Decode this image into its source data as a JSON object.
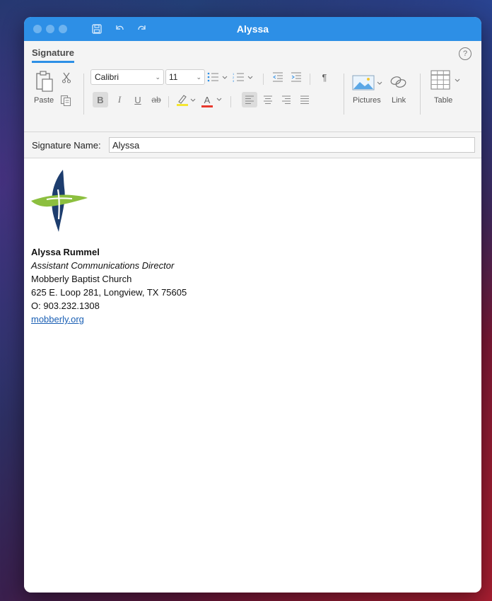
{
  "window": {
    "title": "Alyssa"
  },
  "ribbon": {
    "tab": "Signature",
    "help": "?",
    "paste_label": "Paste",
    "font": "Calibri",
    "font_size": "11",
    "bold": "B",
    "italic": "I",
    "underline": "U",
    "strike": "ab",
    "paragraph": "¶",
    "text_color_glyph": "A",
    "pictures_label": "Pictures",
    "link_label": "Link",
    "table_label": "Table"
  },
  "signature_name": {
    "label": "Signature Name:",
    "value": "Alyssa"
  },
  "signature": {
    "name": "Alyssa Rummel",
    "title": "Assistant Communications Director",
    "org": "Mobberly Baptist Church",
    "address": "625 E. Loop 281, Longview, TX 75605",
    "phone": "O: 903.232.1308",
    "website": "mobberly.org"
  },
  "colors": {
    "accent": "#2d8fe6",
    "logo_blue": "#1d3d6e",
    "logo_green": "#8cbf3f",
    "link": "#1a5fb4"
  }
}
